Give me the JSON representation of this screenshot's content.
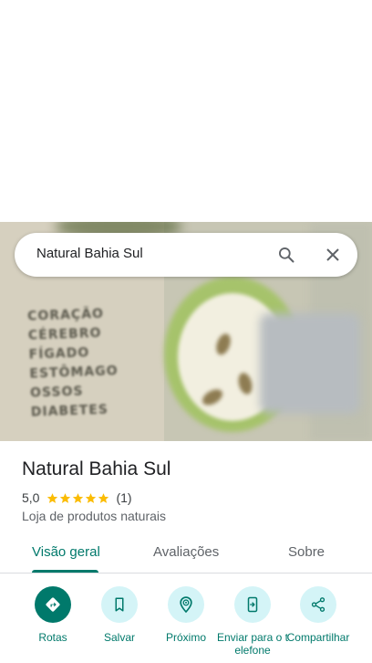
{
  "search": {
    "query": "Natural Bahia Sul"
  },
  "place": {
    "name": "Natural Bahia Sul",
    "rating": "5,0",
    "review_count": "(1)",
    "stars": 5,
    "category": "Loja de produtos naturais"
  },
  "photo_text": [
    "CORAÇÃO",
    "CÉREBRO",
    "FÍGADO",
    "ESTÔMAGO",
    "OSSOS",
    "DIABETES"
  ],
  "tabs": [
    {
      "label": "Visão geral",
      "active": true
    },
    {
      "label": "Avaliações",
      "active": false
    },
    {
      "label": "Sobre",
      "active": false
    }
  ],
  "actions": [
    {
      "label": "Rotas",
      "icon": "directions-icon"
    },
    {
      "label": "Salvar",
      "icon": "bookmark-icon"
    },
    {
      "label": "Próximo",
      "icon": "nearby-icon"
    },
    {
      "label": "Enviar para o telefone",
      "icon": "send-to-phone-icon"
    },
    {
      "label": "Compartilhar",
      "icon": "share-icon"
    }
  ],
  "colors": {
    "accent": "#00796b",
    "star": "#fbbc04",
    "chip": "#d4f4f7"
  }
}
